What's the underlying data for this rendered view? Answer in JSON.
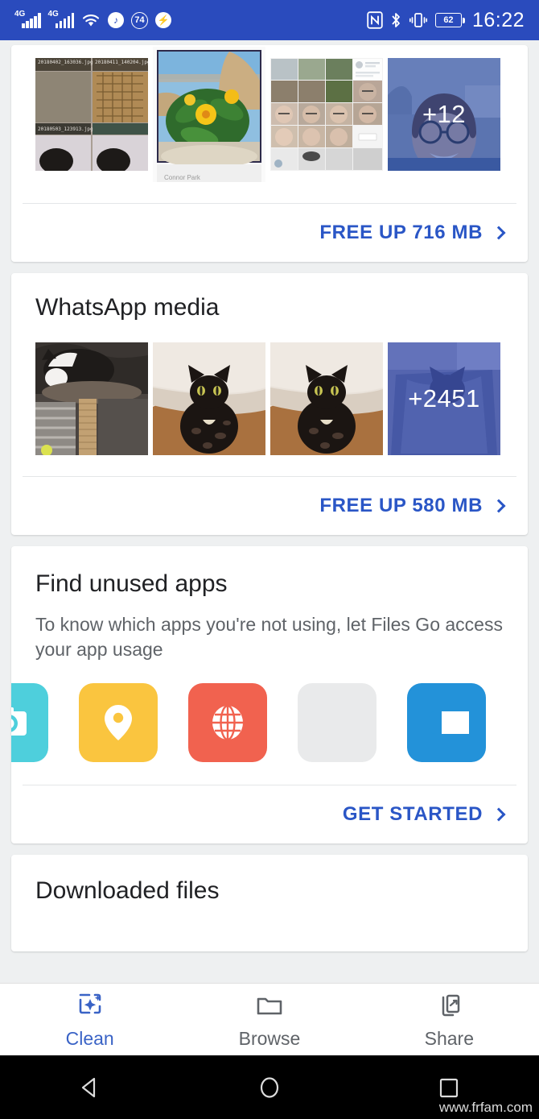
{
  "status_bar": {
    "network_type_1": "4G",
    "network_type_2": "4G",
    "music_icon": "music-note-icon",
    "data_badge": "74",
    "flash_icon": "flash-icon",
    "nfc_icon": "nfc-icon",
    "bluetooth_icon": "bluetooth-icon",
    "vibrate_icon": "vibrate-icon",
    "battery_level": "62",
    "time": "16:22"
  },
  "cards": [
    {
      "id": "junk-photos-card",
      "title": "",
      "thumbnails": [
        {
          "name": "screenshot-collage-thumbnail",
          "overlay": ""
        },
        {
          "name": "flower-photo-thumbnail",
          "overlay": ""
        },
        {
          "name": "gallery-grid-thumbnail",
          "overlay": ""
        },
        {
          "name": "portrait-photo-thumbnail",
          "overlay": "+12"
        }
      ],
      "action_label": "FREE UP 716 MB"
    },
    {
      "id": "whatsapp-media-card",
      "title": "WhatsApp media",
      "thumbnails": [
        {
          "name": "cat-on-tree-thumbnail",
          "overlay": ""
        },
        {
          "name": "black-cat-thumbnail",
          "overlay": ""
        },
        {
          "name": "black-cat-thumbnail-2",
          "overlay": ""
        },
        {
          "name": "cat-in-bag-thumbnail",
          "overlay": "+2451"
        }
      ],
      "action_label": "FREE UP 580 MB"
    },
    {
      "id": "find-unused-apps-card",
      "title": "Find unused apps",
      "description": "To know which apps you're not using, let Files Go access your app usage",
      "app_icons": [
        {
          "name": "camera-app-icon",
          "color": "#4ecfdc"
        },
        {
          "name": "maps-pin-app-icon",
          "color": "#fac53f"
        },
        {
          "name": "browser-globe-app-icon",
          "color": "#f1624f"
        },
        {
          "name": "placeholder-app-icon",
          "color": "#e9eaeb"
        },
        {
          "name": "messaging-app-icon",
          "color": "#2392d9"
        }
      ],
      "action_label": "GET STARTED"
    },
    {
      "id": "downloaded-files-card",
      "title": "Downloaded files"
    }
  ],
  "bottom_nav": [
    {
      "label": "Clean",
      "icon": "clean-sparkle-icon",
      "active": true
    },
    {
      "label": "Browse",
      "icon": "folder-icon",
      "active": false
    },
    {
      "label": "Share",
      "icon": "share-devices-icon",
      "active": false
    }
  ],
  "android_nav": {
    "back": "back-triangle-icon",
    "home": "home-circle-icon",
    "recents": "recents-square-icon"
  },
  "watermark": "www.frfam.com",
  "colors": {
    "status_bar": "#2a4bbd",
    "link": "#2a56c6",
    "active_tab": "#3a63c6",
    "background": "#eef0f1"
  }
}
